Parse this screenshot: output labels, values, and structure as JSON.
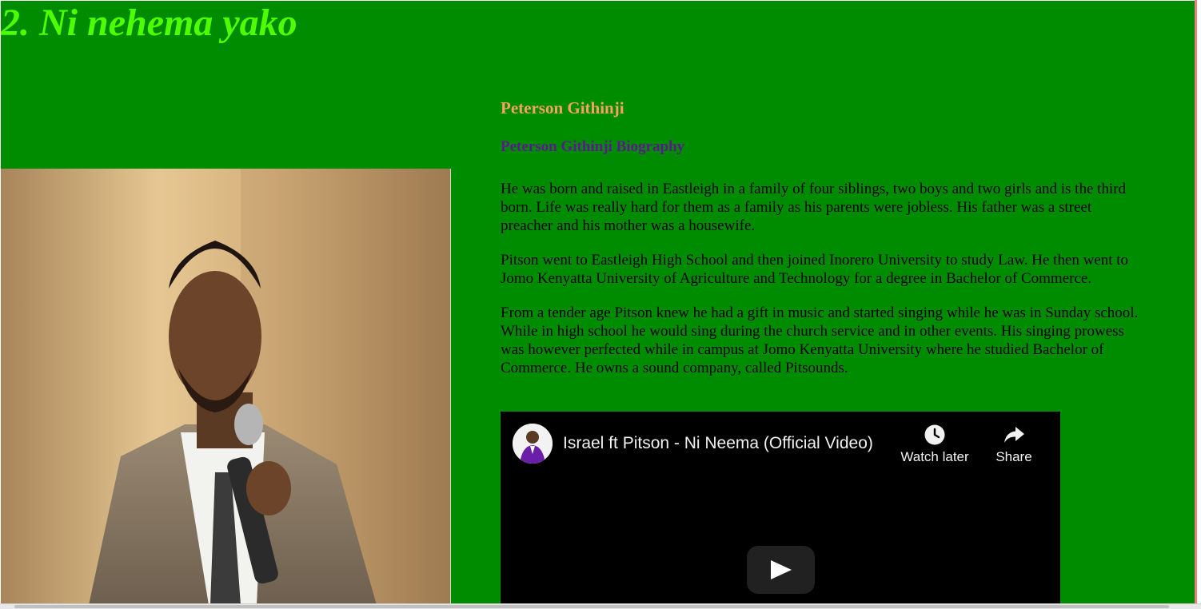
{
  "page": {
    "heading": "2. Ni nehema yako",
    "background_color": "#008c00",
    "heading_color": "#4dff00"
  },
  "artist": {
    "name": "Peterson Githinji",
    "name_color": "#f4a460",
    "bio_title": "Peterson Githinji Biography",
    "bio_title_color": "#5b1a8c",
    "photo_icon": "singer-portrait-photo",
    "paragraphs": [
      "He was born and raised in Eastleigh in a family of four siblings, two boys and two girls and is the third born. Life was really hard for them as a family as his parents were jobless. His father was a street preacher and his mother was a housewife.",
      "Pitson went to Eastleigh High School and then joined Inorero University to study Law. He then went to Jomo Kenyatta University of Agriculture and Technology for a degree in Bachelor of Commerce.",
      "From a tender age Pitson knew he had a gift in music and started singing while he was in Sunday school. While in high school he would sing during the church service and in other events. His singing prowess was however perfected while in campus at Jomo Kenyatta University where he studied Bachelor of Commerce. He owns a sound company, called Pitsounds."
    ]
  },
  "video": {
    "title": "Israel ft Pitson - Ni Neema (Official Video)",
    "watch_later_label": "Watch later",
    "share_label": "Share",
    "watch_later_icon": "clock-icon",
    "share_icon": "share-arrow-icon",
    "play_icon": "play-icon"
  }
}
